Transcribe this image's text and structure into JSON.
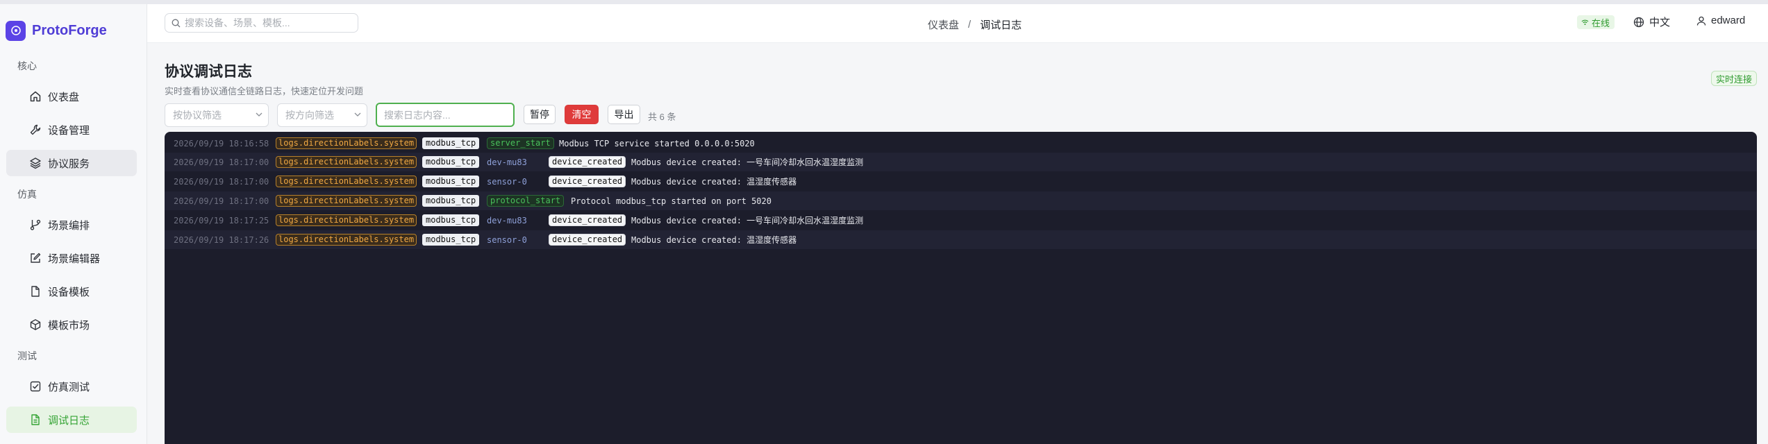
{
  "app": {
    "name": "ProtoForge",
    "brand_color": "#5b43e6"
  },
  "header": {
    "search_placeholder": "搜索设备、场景、模板...",
    "breadcrumb": [
      "仪表盘",
      "调试日志"
    ],
    "breadcrumb_sep": "/",
    "status": "在线",
    "language": "中文",
    "user": "edward"
  },
  "sidebar": {
    "sections": [
      {
        "label": "核心",
        "items": [
          {
            "label": "仪表盘",
            "icon": "home-icon"
          },
          {
            "label": "设备管理",
            "icon": "wrench-icon"
          },
          {
            "label": "协议服务",
            "icon": "layers-icon",
            "state": "selected"
          }
        ]
      },
      {
        "label": "仿真",
        "items": [
          {
            "label": "场景编排",
            "icon": "branch-icon"
          },
          {
            "label": "场景编辑器",
            "icon": "edit-icon"
          },
          {
            "label": "设备模板",
            "icon": "file-icon"
          },
          {
            "label": "模板市场",
            "icon": "box-icon"
          }
        ]
      },
      {
        "label": "测试",
        "items": [
          {
            "label": "仿真测试",
            "icon": "checkbox-icon"
          },
          {
            "label": "调试日志",
            "icon": "document-icon",
            "state": "active"
          }
        ]
      }
    ]
  },
  "page": {
    "title": "协议调试日志",
    "subtitle": "实时查看协议通信全链路日志，快速定位开发问题",
    "live_badge": "实时连接"
  },
  "toolbar": {
    "protocol_filter_placeholder": "按协议筛选",
    "direction_filter_placeholder": "按方向筛选",
    "search_placeholder": "搜索日志内容...",
    "pause_label": "暂停",
    "clear_label": "清空",
    "export_label": "导出",
    "count_label": "共 6 条"
  },
  "logs": [
    {
      "time": "2026/09/19 18:16:58",
      "direction": "logs.directionLabels.system",
      "protocol": "modbus_tcp",
      "device": "",
      "event": "server_start",
      "event_style": "green",
      "message": "Modbus TCP service started 0.0.0.0:5020"
    },
    {
      "time": "2026/09/19 18:17:00",
      "direction": "logs.directionLabels.system",
      "protocol": "modbus_tcp",
      "device": "dev-mu83",
      "event": "device_created",
      "event_style": "white",
      "message": "Modbus device created: 一号车间冷却水回水温湿度监测"
    },
    {
      "time": "2026/09/19 18:17:00",
      "direction": "logs.directionLabels.system",
      "protocol": "modbus_tcp",
      "device": "sensor-0",
      "event": "device_created",
      "event_style": "white",
      "message": "Modbus device created: 温湿度传感器"
    },
    {
      "time": "2026/09/19 18:17:00",
      "direction": "logs.directionLabels.system",
      "protocol": "modbus_tcp",
      "device": "",
      "event": "protocol_start",
      "event_style": "green",
      "message": "Protocol modbus_tcp started on port 5020"
    },
    {
      "time": "2026/09/19 18:17:25",
      "direction": "logs.directionLabels.system",
      "protocol": "modbus_tcp",
      "device": "dev-mu83",
      "event": "device_created",
      "event_style": "white",
      "message": "Modbus device created: 一号车间冷却水回水温湿度监测"
    },
    {
      "time": "2026/09/19 18:17:26",
      "direction": "logs.directionLabels.system",
      "protocol": "modbus_tcp",
      "device": "sensor-0",
      "event": "device_created",
      "event_style": "white",
      "message": "Modbus device created: 温湿度传感器"
    }
  ]
}
